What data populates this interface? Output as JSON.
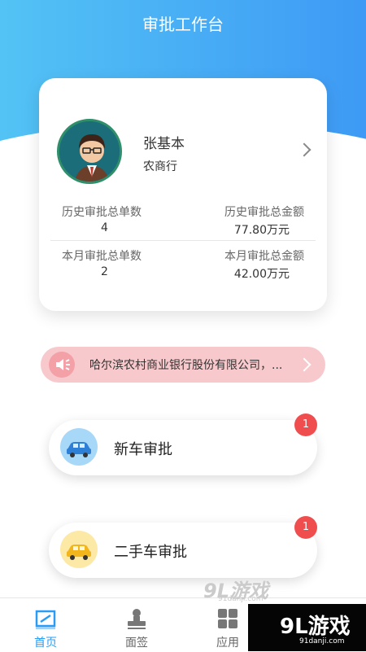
{
  "header": {
    "title": "审批工作台"
  },
  "profile": {
    "name": "张基本",
    "organization": "农商行",
    "stats": {
      "history_total_count_label": "历史审批总单数",
      "history_total_count": "4",
      "history_total_amount_label": "历史审批总金额",
      "history_total_amount": "77.80万元",
      "month_total_count_label": "本月审批总单数",
      "month_total_count": "2",
      "month_total_amount_label": "本月审批总金额",
      "month_total_amount": "42.00万元"
    }
  },
  "notice": {
    "text": "哈尔滨农村商业银行股份有限公司，..."
  },
  "approvals": [
    {
      "label": "新车审批",
      "badge": "1",
      "icon": "car-icon"
    },
    {
      "label": "二手车审批",
      "badge": "1",
      "icon": "used-car-icon"
    }
  ],
  "tabs": [
    {
      "label": "首页",
      "icon": "home-icon",
      "active": true
    },
    {
      "label": "面签",
      "icon": "stamp-icon",
      "active": false
    },
    {
      "label": "应用",
      "icon": "apps-icon",
      "active": false
    }
  ],
  "watermark": {
    "logo_text": "9L游戏",
    "domain": "91danji.com",
    "logo_small_text": "9L游戏",
    "domain_small": "91danji.com"
  },
  "colors": {
    "header_gradient_start": "#53c3f5",
    "header_gradient_end": "#3e9af5",
    "badge": "#f04e4e",
    "notice_bg": "#f8c9cc",
    "active_tab": "#2a9cf5",
    "inactive_tab": "#666666"
  }
}
